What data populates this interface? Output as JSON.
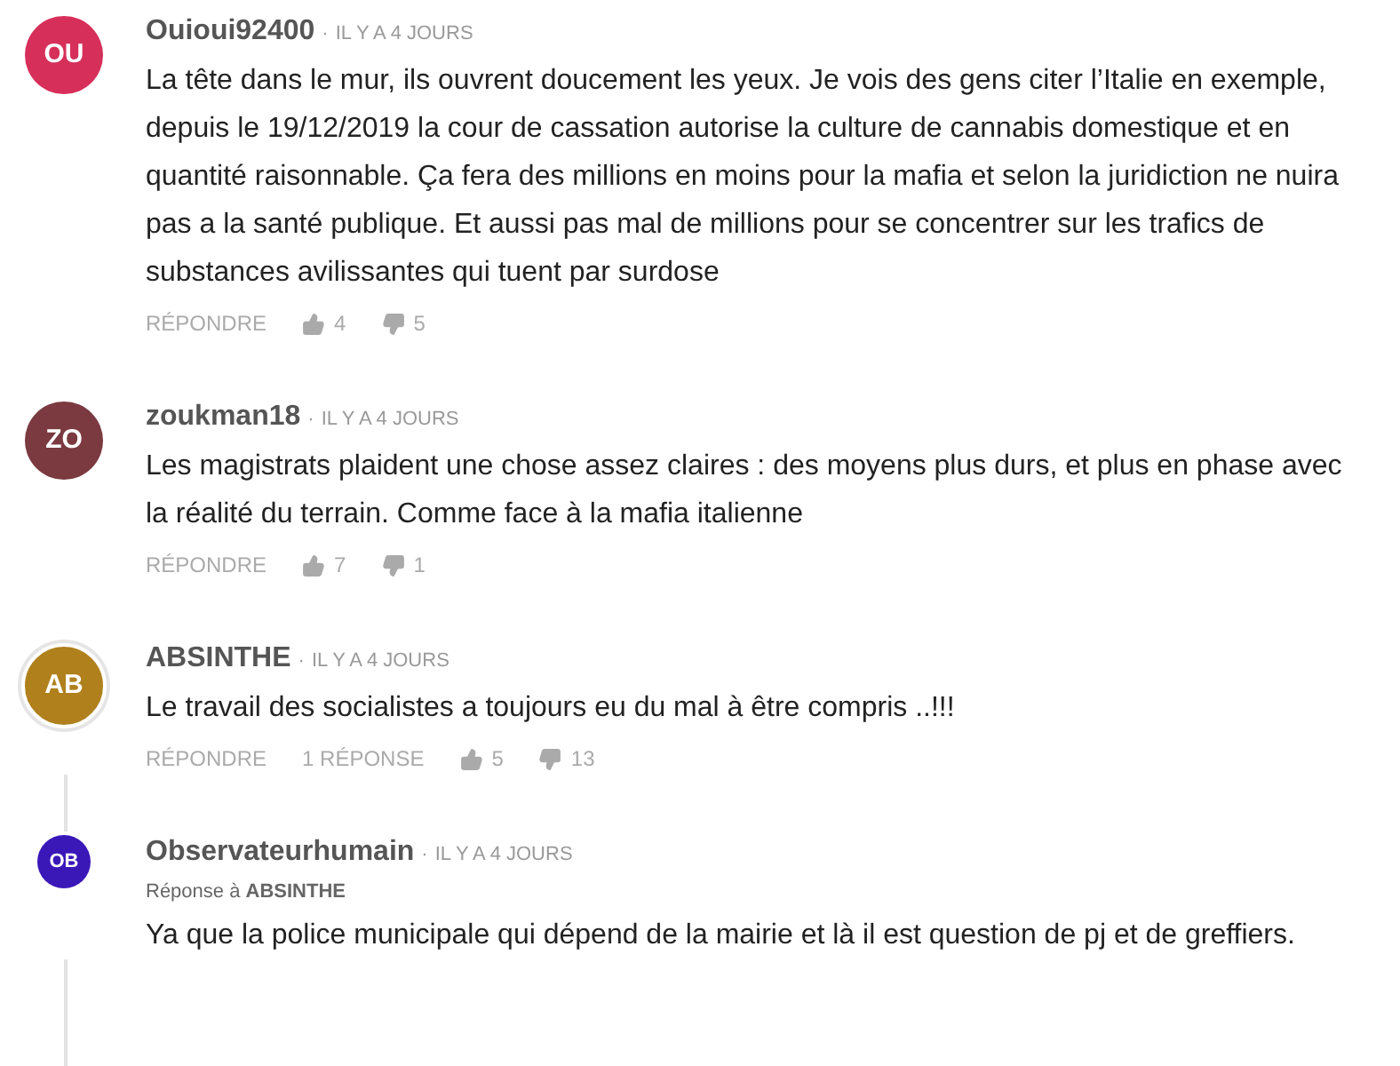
{
  "comments": [
    {
      "kind": "comment",
      "initials": "OU",
      "color": "#d6305a",
      "author": "Ouioui92400",
      "separator": "·",
      "time": "IL Y A 4 JOURS",
      "text": "La tête dans le mur, ils ouvrent doucement les yeux. Je vois des gens citer l’Italie en exemple, depuis le 19/12/2019 la cour de cassation autorise la culture de cannabis domestique et en quantité raisonnable. Ça fera des millions en moins pour la mafia et selon la juridiction ne nuira pas a la santé publique. Et aussi pas mal de millions pour se concentrer sur les trafics de substances avilissantes qui tuent par surdose",
      "reply_label": "RÉPONDRE",
      "likes": "4",
      "dislikes": "5"
    },
    {
      "kind": "comment",
      "initials": "ZO",
      "color": "#7a3a40",
      "author": "zoukman18",
      "separator": "·",
      "time": "IL Y A 4 JOURS",
      "text": "Les magistrats plaident une chose assez claires : des moyens plus durs, et plus en phase avec la réalité du terrain. Comme face à la mafia italienne",
      "reply_label": "RÉPONDRE",
      "likes": "7",
      "dislikes": "1"
    },
    {
      "kind": "thread",
      "initials": "AB",
      "color": "#b0801c",
      "author": "ABSINTHE",
      "separator": "·",
      "time": "IL Y A 4 JOURS",
      "text": "Le travail des socialistes a toujours eu du mal à être compris ..!!!",
      "reply_label": "RÉPONDRE",
      "replies": "1 RÉPONSE",
      "likes": "5",
      "dislikes": "13"
    },
    {
      "kind": "reply",
      "initials": "OB",
      "color": "#3a18b8",
      "author": "Observateurhumain",
      "separator": "·",
      "time": "IL Y A 4 JOURS",
      "in_reply_to": "Réponse à **ABSINTHE**",
      "text": "Ya que la police municipale qui dépend de la mairie et là il est question de pj et de greffiers."
    }
  ]
}
